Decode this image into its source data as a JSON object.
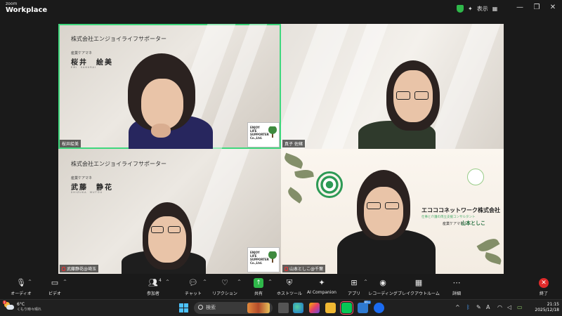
{
  "app": {
    "brand_small": "zoom",
    "brand_large": "Workplace"
  },
  "titlebar": {
    "view_label": "表示",
    "minimize": "—",
    "restore": "❐",
    "close": "✕"
  },
  "tiles": [
    {
      "id": "top-left",
      "company": "株式会社エンジョイライフサポーター",
      "role": "産業ケアマネ",
      "person_name": "桜井　絵美",
      "romaji": "EMI　SAKURAI",
      "logo_text": "ENJOY LIFE SUPPORTER Co.,Ltd.",
      "label": "桜井絵美",
      "active": true
    },
    {
      "id": "top-right",
      "label": "真子 佐緒"
    },
    {
      "id": "bottom-left",
      "company": "株式会社エンジョイライフサポーター",
      "role": "産業ケアマネ",
      "person_name": "武藤　静花",
      "romaji": "SHIZUKA　MUTOU",
      "logo_text": "ENJOY LIFE SUPPORTER Co.,Ltd.",
      "label": "武藤静花@埼玉",
      "muted": true
    },
    {
      "id": "bottom-right",
      "company": "エコココネットワーク株式会社",
      "tagline": "仕事と介護の両立支援コンサルタント",
      "role": "産業ケアマネ",
      "person_name": "山本としこ",
      "label": "山本としこ@千葉",
      "muted": true
    }
  ],
  "toolbar": {
    "audio": "オーディオ",
    "video": "ビデオ",
    "participants": "参加者",
    "participants_count": "4",
    "chat": "チャット",
    "reactions": "リアクション",
    "share": "共有",
    "host_tools": "ホストツール",
    "ai_companion": "AI Companion",
    "apps": "アプリ",
    "recording": "レコーディング",
    "breakout": "ブレイクアウトルーム",
    "more": "詳細",
    "end": "終了",
    "share_color": "#2fb84a",
    "end_color": "#e02b2b"
  },
  "taskbar": {
    "weather_temp": "6°C",
    "weather_desc": "くもり時々晴れ",
    "weather_badge": "1",
    "search_placeholder": "検索",
    "app_badge": "99+",
    "ime": "A",
    "time": "21:15",
    "date": "2025/12/18"
  }
}
